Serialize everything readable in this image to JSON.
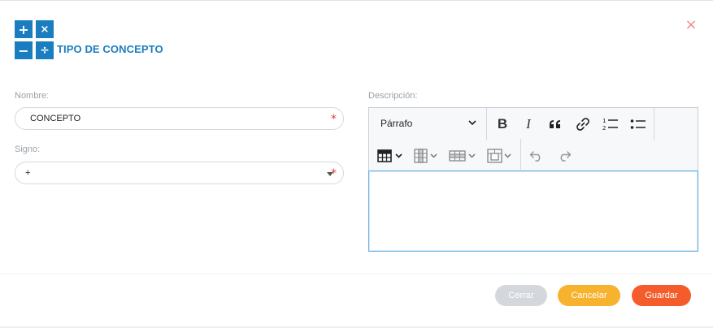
{
  "header": {
    "title": "TIPO DE CONCEPTO",
    "logo_symbols": [
      "+",
      "×",
      "−",
      "÷"
    ],
    "close_symbol": "×"
  },
  "form": {
    "nombre": {
      "label": "Nombre:",
      "value": "CONCEPTO",
      "required_mark": "*"
    },
    "signo": {
      "label": "Signo:",
      "value": "+",
      "required_mark": "*"
    },
    "descripcion": {
      "label": "Descripción:"
    }
  },
  "editor": {
    "heading_select": "Párrafo",
    "toolbar_icons": [
      "bold-icon",
      "italic-icon",
      "blockquote-icon",
      "link-icon",
      "numbered-list-icon",
      "bulleted-list-icon",
      "insert-table-icon",
      "table-column-icon",
      "table-row-icon",
      "merge-cells-icon",
      "undo-icon",
      "redo-icon"
    ]
  },
  "footer": {
    "cerrar": "Cerrar",
    "cancelar": "Cancelar",
    "guardar": "Guardar"
  },
  "colors": {
    "brand_blue": "#1a7dc0",
    "close_red": "#f28b8b",
    "cerrar_gray": "#d4d8dc",
    "cancelar_orange": "#f7b22e",
    "guardar_orange": "#f45d2b"
  }
}
